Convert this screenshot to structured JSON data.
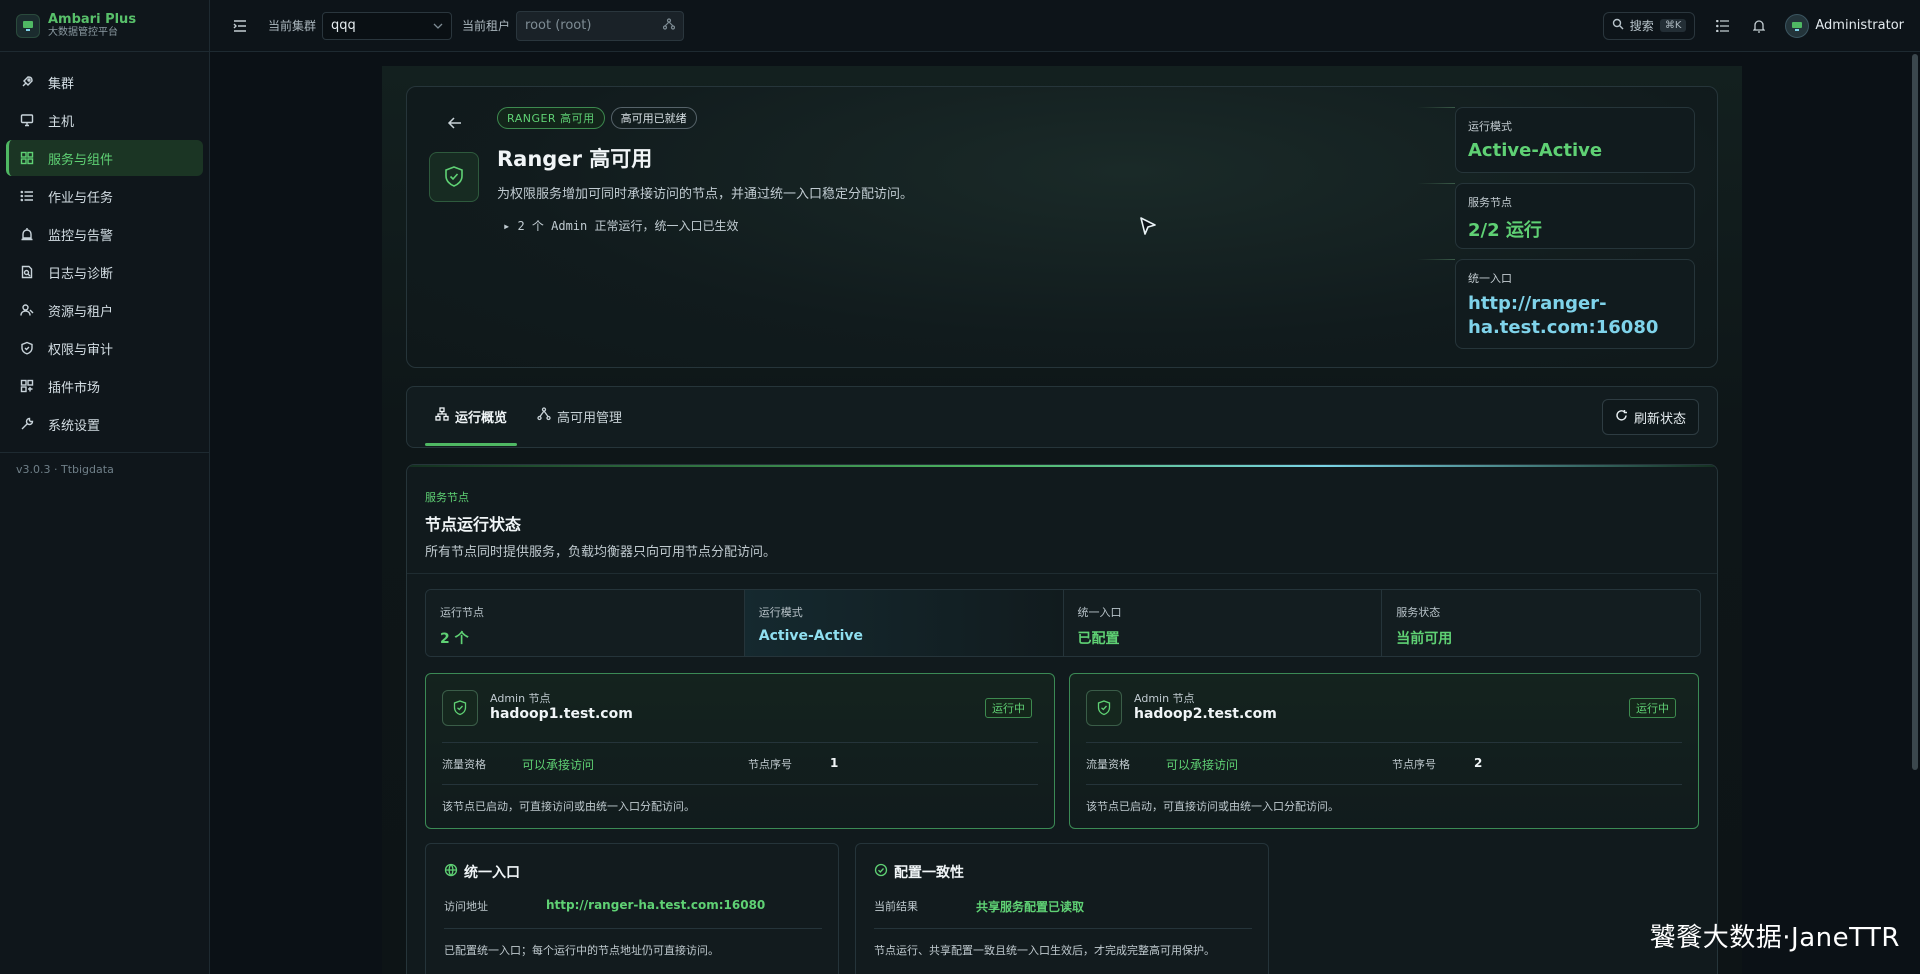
{
  "brand": {
    "title": "Ambari Plus",
    "subtitle": "大数据管控平台"
  },
  "sidebar": {
    "items": [
      {
        "label": "集群",
        "icon": "rocket-icon"
      },
      {
        "label": "主机",
        "icon": "monitor-icon"
      },
      {
        "label": "服务与组件",
        "icon": "grid-icon",
        "active": true
      },
      {
        "label": "作业与任务",
        "icon": "list-icon"
      },
      {
        "label": "监控与告警",
        "icon": "alarm-icon"
      },
      {
        "label": "日志与诊断",
        "icon": "file-search-icon"
      },
      {
        "label": "资源与租户",
        "icon": "users-icon"
      },
      {
        "label": "权限与审计",
        "icon": "shield-icon"
      },
      {
        "label": "插件市场",
        "icon": "plugin-icon"
      },
      {
        "label": "系统设置",
        "icon": "wrench-icon"
      }
    ],
    "version": "v3.0.3 · Ttbigdata"
  },
  "topbar": {
    "cluster_label": "当前集群",
    "cluster_value": "qqq",
    "tenant_label": "当前租户",
    "tenant_placeholder": "root (root)",
    "search_label": "搜索",
    "search_shortcut": "⌘K",
    "user_name": "Administrator"
  },
  "hero": {
    "badge_primary": "RANGER 高可用",
    "badge_secondary": "高可用已就绪",
    "title": "Ranger 高可用",
    "description": "为权限服务增加可同时承接访问的节点，并通过统一入口稳定分配访问。",
    "summary": "▸ 2 个 Admin 正常运行，统一入口已生效",
    "stats": [
      {
        "label": "运行模式",
        "value": "Active-Active"
      },
      {
        "label": "服务节点",
        "value": "2/2 运行"
      },
      {
        "label": "统一入口",
        "value_line1": "http://ranger-",
        "value_line2": "ha.test.com:16080"
      }
    ]
  },
  "tabs": [
    {
      "label": "运行概览",
      "active": true
    },
    {
      "label": "高可用管理",
      "active": false
    }
  ],
  "refresh_label": "刷新状态",
  "section": {
    "kicker": "服务节点",
    "title": "节点运行状态",
    "description": "所有节点同时提供服务，负载均衡器只向可用节点分配访问。"
  },
  "metrics": [
    {
      "label": "运行节点",
      "value": "2 个"
    },
    {
      "label": "运行模式",
      "value": "Active-Active"
    },
    {
      "label": "统一入口",
      "value": "已配置"
    },
    {
      "label": "服务状态",
      "value": "当前可用"
    }
  ],
  "nodes": [
    {
      "kicker": "Admin 节点",
      "host": "hadoop1.test.com",
      "status": "运行中",
      "traffic_label": "流量资格",
      "traffic_value": "可以承接访问",
      "seq_label": "节点序号",
      "seq_value": "1",
      "note": "该节点已启动，可直接访问或由统一入口分配访问。"
    },
    {
      "kicker": "Admin 节点",
      "host": "hadoop2.test.com",
      "status": "运行中",
      "traffic_label": "流量资格",
      "traffic_value": "可以承接访问",
      "seq_label": "节点序号",
      "seq_value": "2",
      "note": "该节点已启动，可直接访问或由统一入口分配访问。"
    }
  ],
  "entry_card": {
    "title": "统一入口",
    "key": "访问地址",
    "value": "http://ranger-ha.test.com:16080",
    "note": "已配置统一入口；每个运行中的节点地址仍可直接访问。"
  },
  "config_card": {
    "title": "配置一致性",
    "key": "当前结果",
    "value": "共享服务配置已读取",
    "note": "节点运行、共享配置一致且统一入口生效后，才完成完整高可用保护。"
  },
  "watermark": "饕餮大数据·JaneTTR",
  "colors": {
    "accent": "#5fd174",
    "link": "#7fd3ea",
    "background": "#0b1116"
  }
}
